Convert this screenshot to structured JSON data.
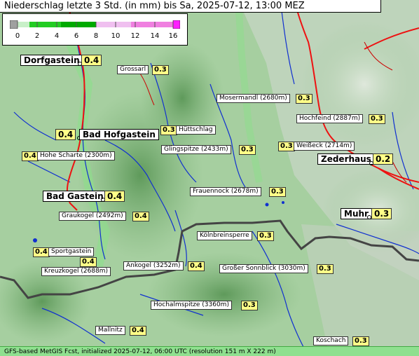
{
  "title": "Niederschlag letzte 3 Std. (in mm) bis Sa, 2025-07-12, 13:00 MEZ",
  "legend": {
    "ticks": [
      "0",
      "2",
      "4",
      "6",
      "8",
      "10",
      "12",
      "14",
      "16"
    ],
    "colors": {
      "below_zero": "#a0a0a0",
      "light": "#c8f0c8",
      "green_light": "#22cc22",
      "green_dark": "#00aa00",
      "pink_light": "#f0c0f0",
      "pink": "#f080e0",
      "magenta": "#ff20ff"
    }
  },
  "towns": [
    {
      "name": "Dorfgastein",
      "value": "0.4"
    },
    {
      "name": "Bad Hofgastein",
      "value": "0.4"
    },
    {
      "name": "Zederhaus",
      "value": "0.2"
    },
    {
      "name": "Bad Gastein",
      "value": "0.4"
    },
    {
      "name": "Muhr",
      "value": "0.3"
    }
  ],
  "places": [
    {
      "name": "Grossarl",
      "value": "0.3"
    },
    {
      "name": "Mosermandl (2680m)",
      "value": "0.3"
    },
    {
      "name": "Hochfeind (2887m)",
      "value": "0.3"
    },
    {
      "name": "Hüttschlag",
      "value": "0.3"
    },
    {
      "name": "Glingspitze (2433m)",
      "value": "0.3"
    },
    {
      "name": "Weißeck (2714m)",
      "value": "0.3"
    },
    {
      "name": "Hohe Scharte (2300m)",
      "value": "0.4"
    },
    {
      "name": "Frauennock (2678m)",
      "value": "0.3"
    },
    {
      "name": "Graukogel (2492m)",
      "value": "0.4"
    },
    {
      "name": "Kölnbreinsperre",
      "value": "0.3"
    },
    {
      "name": "Sportgastein",
      "value": "0.4"
    },
    {
      "name": "Kreuzkogel (2688m)",
      "value": "0.4"
    },
    {
      "name": "Ankogel (3252m)",
      "value": "0.4"
    },
    {
      "name": "Großer Sonnblick (3030m)",
      "value": "0.3"
    },
    {
      "name": "Hochalmspitze (3360m)",
      "value": "0.3"
    },
    {
      "name": "Mallnitz",
      "value": "0.4"
    },
    {
      "name": "Koschach",
      "value": "0.3"
    }
  ],
  "footer": "GFS-based MetGIS Fcst, initialized 2025-07-12, 06:00 UTC  (resolution 151 m X 222 m)"
}
